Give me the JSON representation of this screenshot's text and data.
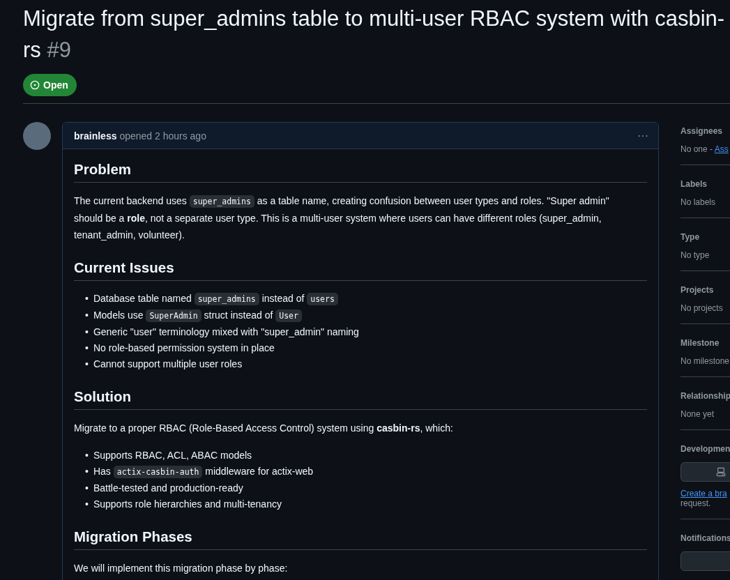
{
  "issue": {
    "title": "Migrate from super_admins table to multi-user RBAC system with casbin-rs",
    "number": "#9",
    "state": {
      "kind": "open",
      "label": "Open"
    }
  },
  "comment": {
    "author": "brainless",
    "meta": "opened 2 hours ago",
    "menu": "···",
    "blocks": [
      {
        "kind": "heading",
        "text": "Problem"
      },
      {
        "kind": "paragraph",
        "segments": [
          {
            "kind": "text",
            "text": "The current backend uses "
          },
          {
            "kind": "code",
            "text": "super_admins"
          },
          {
            "kind": "text",
            "text": " as a table name, creating confusion between user types and roles. \"Super admin\" should be a **role**, not a separate user type. This is a multi-user system where users can have different roles (super_admin, tenant_admin, volunteer)."
          }
        ]
      },
      {
        "kind": "heading",
        "text": "Current Issues"
      },
      {
        "kind": "list",
        "marker": "•",
        "items": [
          [
            {
              "kind": "text",
              "text": "Database table named "
            },
            {
              "kind": "code",
              "text": "super_admins"
            },
            {
              "kind": "text",
              "text": " instead of "
            },
            {
              "kind": "code",
              "text": "users"
            }
          ],
          [
            {
              "kind": "text",
              "text": "Models use "
            },
            {
              "kind": "code",
              "text": "SuperAdmin"
            },
            {
              "kind": "text",
              "text": " struct instead of "
            },
            {
              "kind": "code",
              "text": "User"
            }
          ],
          [
            {
              "kind": "text",
              "text": "Generic \"user\" terminology mixed with \"super_admin\" naming"
            }
          ],
          [
            {
              "kind": "text",
              "text": "No role-based permission system in place"
            }
          ],
          [
            {
              "kind": "text",
              "text": "Cannot support multiple user roles"
            }
          ]
        ]
      },
      {
        "kind": "heading",
        "text": "Solution"
      },
      {
        "kind": "paragraph",
        "segments": [
          {
            "kind": "text",
            "text": "Migrate to a proper RBAC (Role-Based Access Control) system using **casbin-rs**, which:"
          }
        ]
      },
      {
        "kind": "list",
        "marker": "•",
        "items": [
          [
            {
              "kind": "text",
              "text": "Supports RBAC, ACL, ABAC models"
            }
          ],
          [
            {
              "kind": "text",
              "text": "Has "
            },
            {
              "kind": "code",
              "text": "actix-casbin-auth"
            },
            {
              "kind": "text",
              "text": " middleware for actix-web"
            }
          ],
          [
            {
              "kind": "text",
              "text": "Battle-tested and production-ready"
            }
          ],
          [
            {
              "kind": "text",
              "text": "Supports role hierarchies and multi-tenancy"
            }
          ]
        ]
      },
      {
        "kind": "heading",
        "text": "Migration Phases"
      },
      {
        "kind": "paragraph",
        "segments": [
          {
            "kind": "text",
            "text": "We will implement this migration phase by phase:"
          }
        ]
      }
    ]
  },
  "sidebar": {
    "sections": [
      {
        "title": "Assignees",
        "kind": "text",
        "value": "No one - ",
        "link": "Ass"
      },
      {
        "title": "Labels",
        "kind": "text",
        "value": "No labels"
      },
      {
        "title": "Type",
        "kind": "text",
        "value": "No type"
      },
      {
        "title": "Projects",
        "kind": "text",
        "value": "No projects"
      },
      {
        "title": "Milestone",
        "kind": "text",
        "value": "No milestone"
      },
      {
        "title": "Relationship",
        "kind": "text",
        "value": "None yet"
      },
      {
        "title": "Developmen",
        "kind": "development",
        "link": "Create a bra",
        "value": "request."
      },
      {
        "title": "Notifications",
        "kind": "notifications"
      }
    ]
  }
}
